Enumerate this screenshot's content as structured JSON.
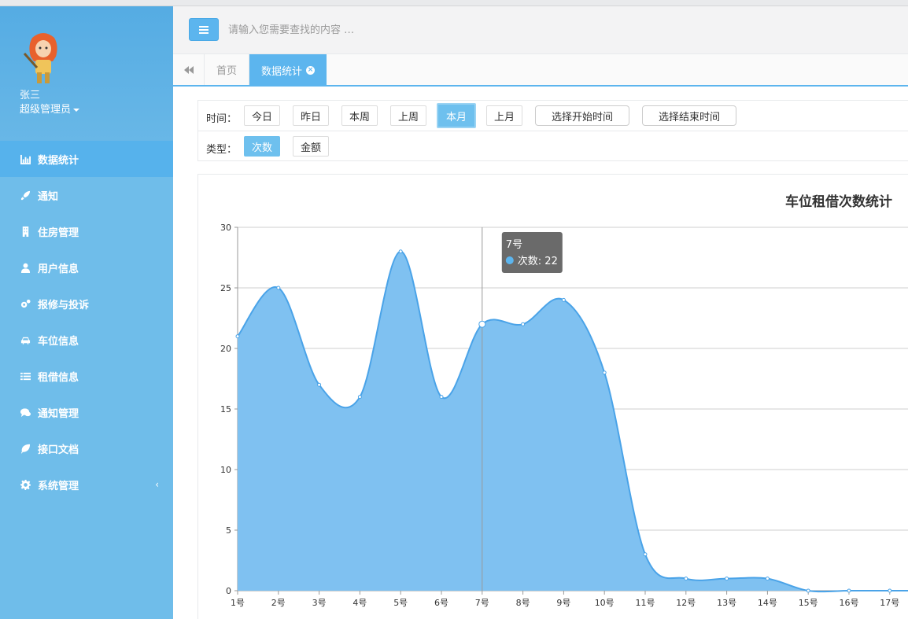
{
  "user": {
    "name": "张三",
    "role": "超级管理员"
  },
  "search": {
    "placeholder": "请输入您需要查找的内容 …"
  },
  "menu": [
    {
      "label": "数据统计",
      "icon": "bar-chart-icon",
      "active": true
    },
    {
      "label": "通知",
      "icon": "rocket-icon"
    },
    {
      "label": "住房管理",
      "icon": "building-icon"
    },
    {
      "label": "用户信息",
      "icon": "user-icon"
    },
    {
      "label": "报修与投诉",
      "icon": "cogs-icon"
    },
    {
      "label": "车位信息",
      "icon": "car-icon"
    },
    {
      "label": "租借信息",
      "icon": "list-icon"
    },
    {
      "label": "通知管理",
      "icon": "comments-icon"
    },
    {
      "label": "接口文档",
      "icon": "leaf-icon"
    },
    {
      "label": "系统管理",
      "icon": "gear-icon",
      "arrow": "‹"
    }
  ],
  "tabs": {
    "home": "首页",
    "active": "数据统计"
  },
  "filters": {
    "time_label": "时间：",
    "type_label": "类型：",
    "time_options": [
      "今日",
      "昨日",
      "本周",
      "上周",
      "本月",
      "上月"
    ],
    "selected_time": "本月",
    "start_label": "选择开始时间",
    "end_label": "选择结束时间",
    "type_options": [
      "次数",
      "金额"
    ],
    "selected_type": "次数"
  },
  "colors": {
    "accent": "#5cb5ee",
    "area": "#7fc1f1",
    "line": "#4aa3e8",
    "sidebar": "#6fbdea"
  },
  "chart_data": {
    "type": "area",
    "title": "车位租借次数统计",
    "categories": [
      "1号",
      "2号",
      "3号",
      "4号",
      "5号",
      "6号",
      "7号",
      "8号",
      "9号",
      "10号",
      "11号",
      "12号",
      "13号",
      "14号",
      "15号",
      "16号",
      "17号"
    ],
    "series": [
      {
        "name": "次数",
        "values": [
          21,
          25,
          17,
          16,
          28,
          16,
          22,
          22,
          24,
          18,
          3,
          1,
          1,
          1,
          0,
          0,
          0
        ]
      }
    ],
    "ylim": [
      0,
      30
    ],
    "yticks": [
      0,
      5,
      10,
      15,
      20,
      25,
      30
    ],
    "grid": true,
    "tooltip": {
      "category": "7号",
      "series": "次数",
      "value": 22
    }
  }
}
